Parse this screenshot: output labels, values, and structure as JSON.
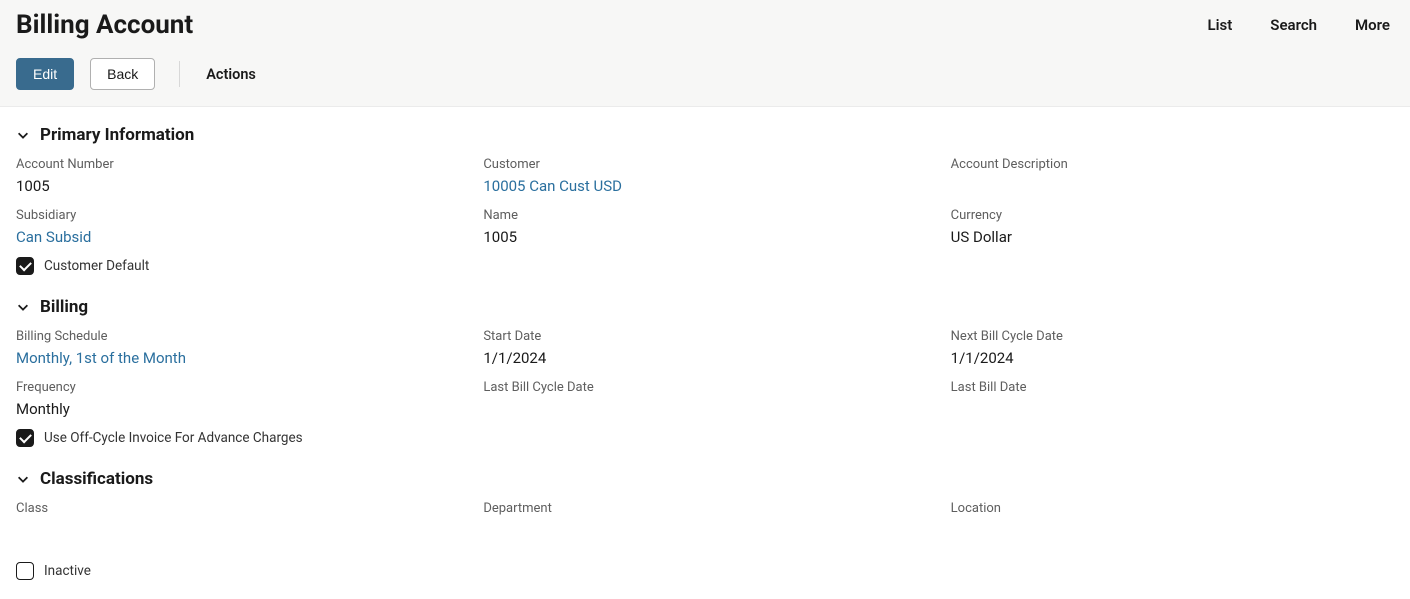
{
  "header": {
    "title": "Billing Account",
    "links": {
      "list": "List",
      "search": "Search",
      "more": "More"
    },
    "buttons": {
      "edit": "Edit",
      "back": "Back",
      "actions": "Actions"
    }
  },
  "sections": {
    "primary": {
      "title": "Primary Information",
      "account_number_label": "Account Number",
      "account_number": "1005",
      "customer_label": "Customer",
      "customer": "10005 Can Cust USD",
      "account_description_label": "Account Description",
      "account_description": "",
      "subsidiary_label": "Subsidiary",
      "subsidiary": "Can Subsid",
      "name_label": "Name",
      "name": "1005",
      "currency_label": "Currency",
      "currency": "US Dollar",
      "customer_default_label": "Customer Default"
    },
    "billing": {
      "title": "Billing",
      "billing_schedule_label": "Billing Schedule",
      "billing_schedule": "Monthly, 1st of the Month",
      "start_date_label": "Start Date",
      "start_date": "1/1/2024",
      "next_bill_cycle_label": "Next Bill Cycle Date",
      "next_bill_cycle": "1/1/2024",
      "frequency_label": "Frequency",
      "frequency": "Monthly",
      "last_bill_cycle_label": "Last Bill Cycle Date",
      "last_bill_cycle": "",
      "last_bill_date_label": "Last Bill Date",
      "last_bill_date": "",
      "offcycle_label": "Use Off-Cycle Invoice For Advance Charges"
    },
    "classifications": {
      "title": "Classifications",
      "class_label": "Class",
      "class": "",
      "department_label": "Department",
      "department": "",
      "location_label": "Location",
      "location": ""
    },
    "inactive_label": "Inactive"
  }
}
